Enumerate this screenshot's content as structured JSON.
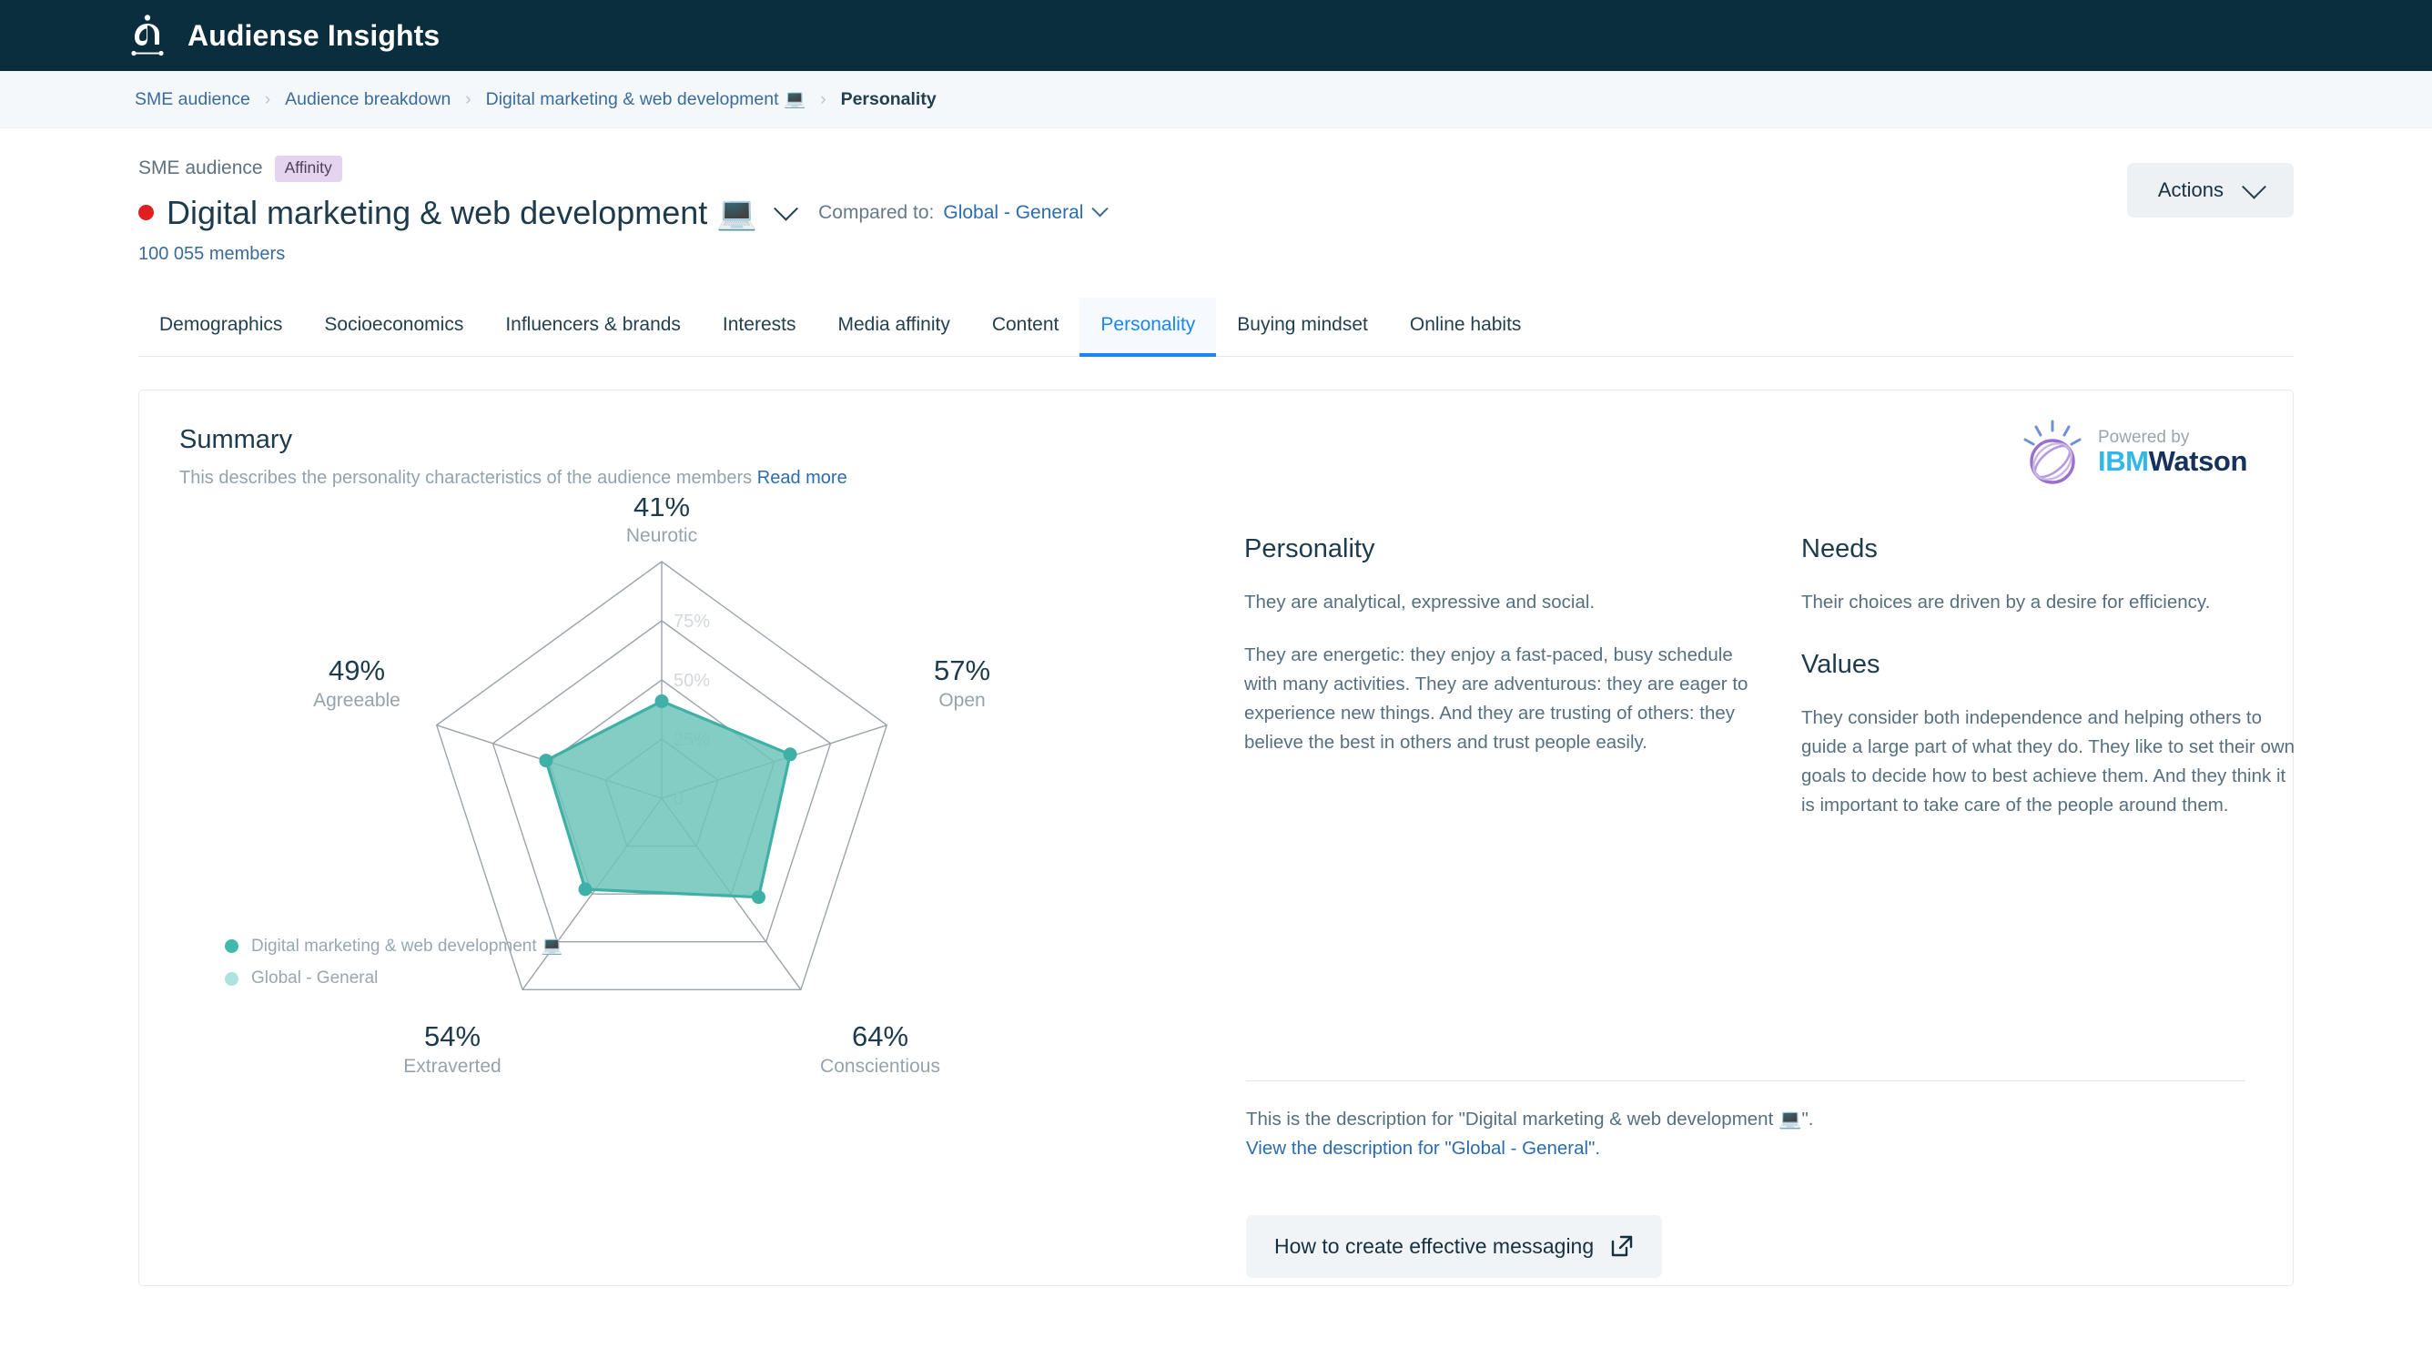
{
  "app": {
    "title": "Audiense Insights",
    "logo_icon": "audiense-logo-icon",
    "topbar_color": "#0b2e3f"
  },
  "breadcrumb": {
    "items": [
      {
        "label": "SME audience",
        "current": false
      },
      {
        "label": "Audience breakdown",
        "current": false
      },
      {
        "label": "Digital marketing & web development 💻",
        "current": false
      },
      {
        "label": "Personality",
        "current": true
      }
    ],
    "separator": "›"
  },
  "header": {
    "eyebrow": "SME audience",
    "badge": "Affinity",
    "badge_color": "#e4d4f0",
    "status_dot_color": "#e02020",
    "title": "Digital marketing & web development 💻",
    "title_dropdown_icon": "chevron-down-icon",
    "compared_to_label": "Compared to:",
    "compared_to_value": "Global - General",
    "compared_to_icon": "chevron-down-icon",
    "members": "100 055 members",
    "actions_label": "Actions",
    "actions_icon": "chevron-down-icon"
  },
  "tabs": {
    "items": [
      {
        "label": "Demographics",
        "active": false
      },
      {
        "label": "Socioeconomics",
        "active": false
      },
      {
        "label": "Influencers & brands",
        "active": false
      },
      {
        "label": "Interests",
        "active": false
      },
      {
        "label": "Media affinity",
        "active": false
      },
      {
        "label": "Content",
        "active": false
      },
      {
        "label": "Personality",
        "active": true
      },
      {
        "label": "Buying mindset",
        "active": false
      },
      {
        "label": "Online habits",
        "active": false
      }
    ],
    "active_color": "#1a86f0"
  },
  "card": {
    "title": "Summary",
    "subtitle": "This describes the personality characteristics of the audience members",
    "read_more": "Read more",
    "watson": {
      "powered_by": "Powered by",
      "brand_ibm": "IBM",
      "brand_watson": "Watson",
      "logo_icon": "ibm-watson-orb-icon"
    }
  },
  "chart_data": {
    "type": "radar",
    "title": "",
    "categories": [
      "Neurotic",
      "Open",
      "Conscientious",
      "Extraverted",
      "Agreeable"
    ],
    "values": [
      41,
      57,
      64,
      54,
      49
    ],
    "value_labels": [
      "41%",
      "57%",
      "64%",
      "54%",
      "49%"
    ],
    "ring_labels": [
      "0",
      "25%",
      "50%",
      "75%"
    ],
    "ring_values": [
      0,
      25,
      50,
      75
    ],
    "ylim": [
      0,
      100
    ],
    "grid": true,
    "series": [
      {
        "name": "Digital marketing & web development 💻",
        "values": [
          41,
          57,
          64,
          54,
          49
        ],
        "color": "#5cbfb5"
      },
      {
        "name": "Global - General",
        "values": [],
        "color": "#abe0da"
      }
    ],
    "legend_position": "bottom-left",
    "fill_color": "#6ec4bb",
    "stroke_color": "#3fb0a5"
  },
  "insights": {
    "personality_heading": "Personality",
    "personality_p1": "They are analytical, expressive and social.",
    "personality_p2": "They are energetic: they enjoy a fast-paced, busy schedule with many activities. They are adventurous: they are eager to experience new things. And they are trusting of others: they believe the best in others and trust people easily.",
    "needs_heading": "Needs",
    "needs_p1": "Their choices are driven by a desire for efficiency.",
    "values_heading": "Values",
    "values_p1": "They consider both independence and helping others to guide a large part of what they do. They like to set their own goals to decide how to best achieve them. And they think it is important to take care of the people around them."
  },
  "footer": {
    "description_line": "This is the description for \"Digital marketing & web development 💻\".",
    "view_description_link": "View the description for \"Global - General\".",
    "messaging_button": "How to create effective messaging",
    "messaging_button_icon": "external-link-icon"
  }
}
